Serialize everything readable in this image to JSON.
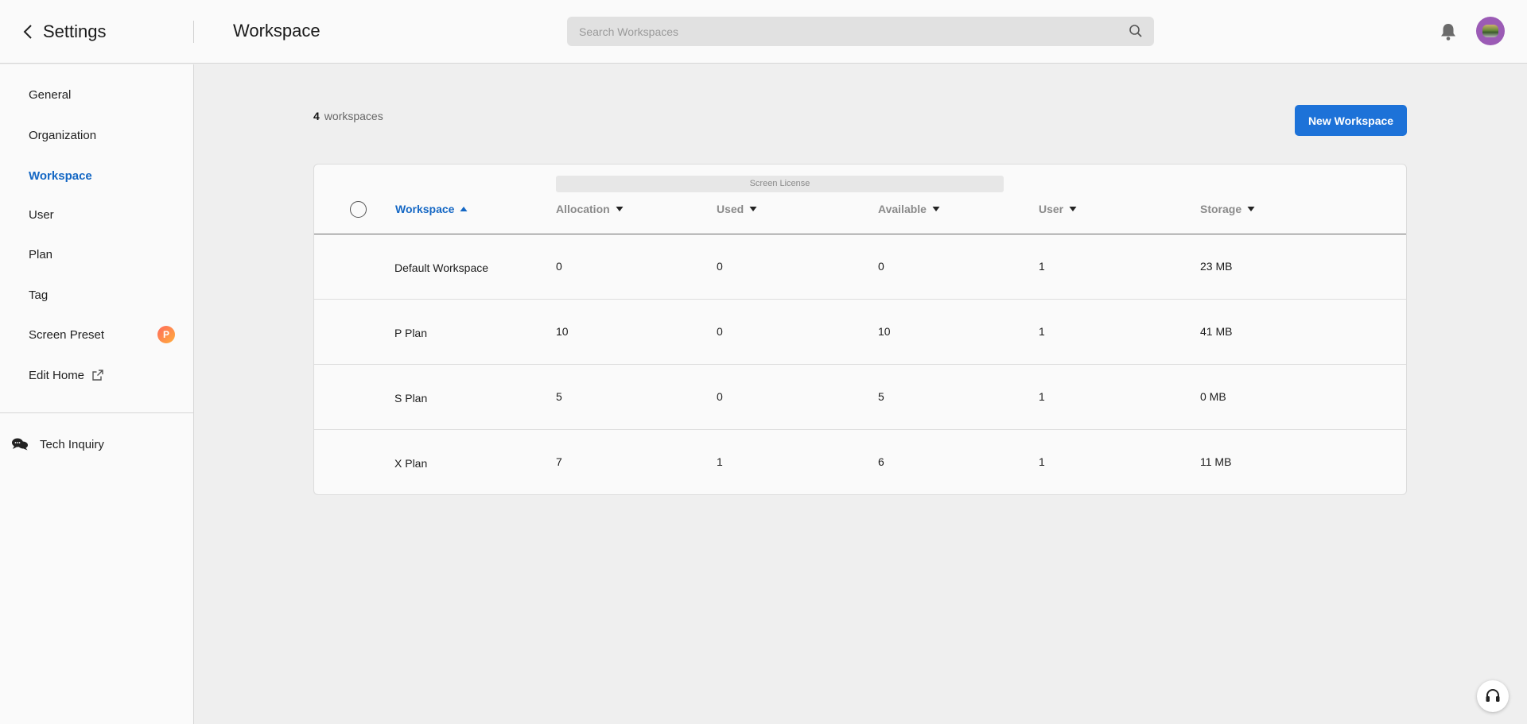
{
  "header": {
    "back_label": "Settings",
    "page_title": "Workspace",
    "search_placeholder": "Search Workspaces"
  },
  "sidebar": {
    "items": [
      {
        "label": "General"
      },
      {
        "label": "Organization"
      },
      {
        "label": "Workspace",
        "active": true
      },
      {
        "label": "User"
      },
      {
        "label": "Plan"
      },
      {
        "label": "Tag"
      },
      {
        "label": "Screen Preset",
        "badge": "P"
      },
      {
        "label": "Edit Home"
      }
    ],
    "tech_inquiry": "Tech Inquiry"
  },
  "main": {
    "count_number": "4",
    "count_label": "workspaces",
    "new_button": "New Workspace",
    "license_group": "Screen License",
    "columns": [
      "Workspace",
      "Allocation",
      "Used",
      "Available",
      "User",
      "Storage"
    ],
    "rows": [
      {
        "name": "Default Workspace",
        "allocation": "0",
        "used": "0",
        "available": "0",
        "user": "1",
        "storage": "23 MB"
      },
      {
        "name": "P Plan",
        "allocation": "10",
        "used": "0",
        "available": "10",
        "user": "1",
        "storage": "41 MB"
      },
      {
        "name": "S Plan",
        "allocation": "5",
        "used": "0",
        "available": "5",
        "user": "1",
        "storage": "0 MB"
      },
      {
        "name": "X Plan",
        "allocation": "7",
        "used": "1",
        "available": "6",
        "user": "1",
        "storage": "11 MB"
      }
    ]
  },
  "colors": {
    "accent": "#1467c4",
    "button": "#1d72d8",
    "badge": "#ff8a4c"
  },
  "icons": [
    "chevron-left-icon",
    "search-icon",
    "bell-icon",
    "avatar",
    "external-link-icon",
    "chat-icon",
    "sort-asc-icon",
    "sort-desc-icon",
    "headset-icon"
  ]
}
